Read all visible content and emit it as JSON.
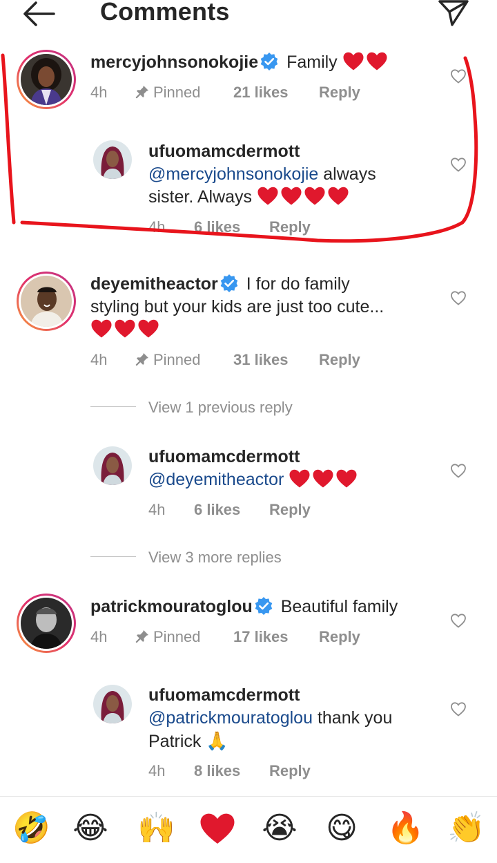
{
  "header": {
    "title": "Comments"
  },
  "comments": [
    {
      "user": "mercyjohnsonokojie",
      "verified": true,
      "text": "Family",
      "time": "4h",
      "pinned": "Pinned",
      "likes": "21 likes",
      "reply": "Reply",
      "replies": [
        {
          "user": "ufuomamcdermott",
          "mention": "@mercyjohnsonokojie",
          "text_line1": "always",
          "text_line2": "sister. Always",
          "time": "4h",
          "likes": "6 likes",
          "reply": "Reply"
        }
      ]
    },
    {
      "user": "deyemitheactor",
      "verified": true,
      "text_line1": "I for do family",
      "text_line2": "styling but your kids are just too cute...",
      "time": "4h",
      "pinned": "Pinned",
      "likes": "31 likes",
      "reply": "Reply",
      "view_previous": "View 1 previous reply",
      "replies": [
        {
          "user": "ufuomamcdermott",
          "mention": "@deyemitheactor",
          "time": "4h",
          "likes": "6 likes",
          "reply": "Reply"
        }
      ],
      "view_more": "View 3 more replies"
    },
    {
      "user": "patrickmouratoglou",
      "verified": true,
      "text": "Beautiful family",
      "time": "4h",
      "pinned": "Pinned",
      "likes": "17 likes",
      "reply": "Reply",
      "replies": [
        {
          "user": "ufuomamcdermott",
          "mention": "@patrickmouratoglou",
          "text_line1": "thank you",
          "text_line2": "Patrick",
          "time": "4h",
          "likes": "8 likes",
          "reply": "Reply"
        }
      ]
    }
  ],
  "emoji_bar": [
    "🤣",
    "😂",
    "🙌",
    "❤️",
    "😭",
    "😋",
    "🔥",
    "👏"
  ],
  "colors": {
    "heart": "#e0182d",
    "verified": "#3897f0",
    "annotation": "#e8141c"
  }
}
